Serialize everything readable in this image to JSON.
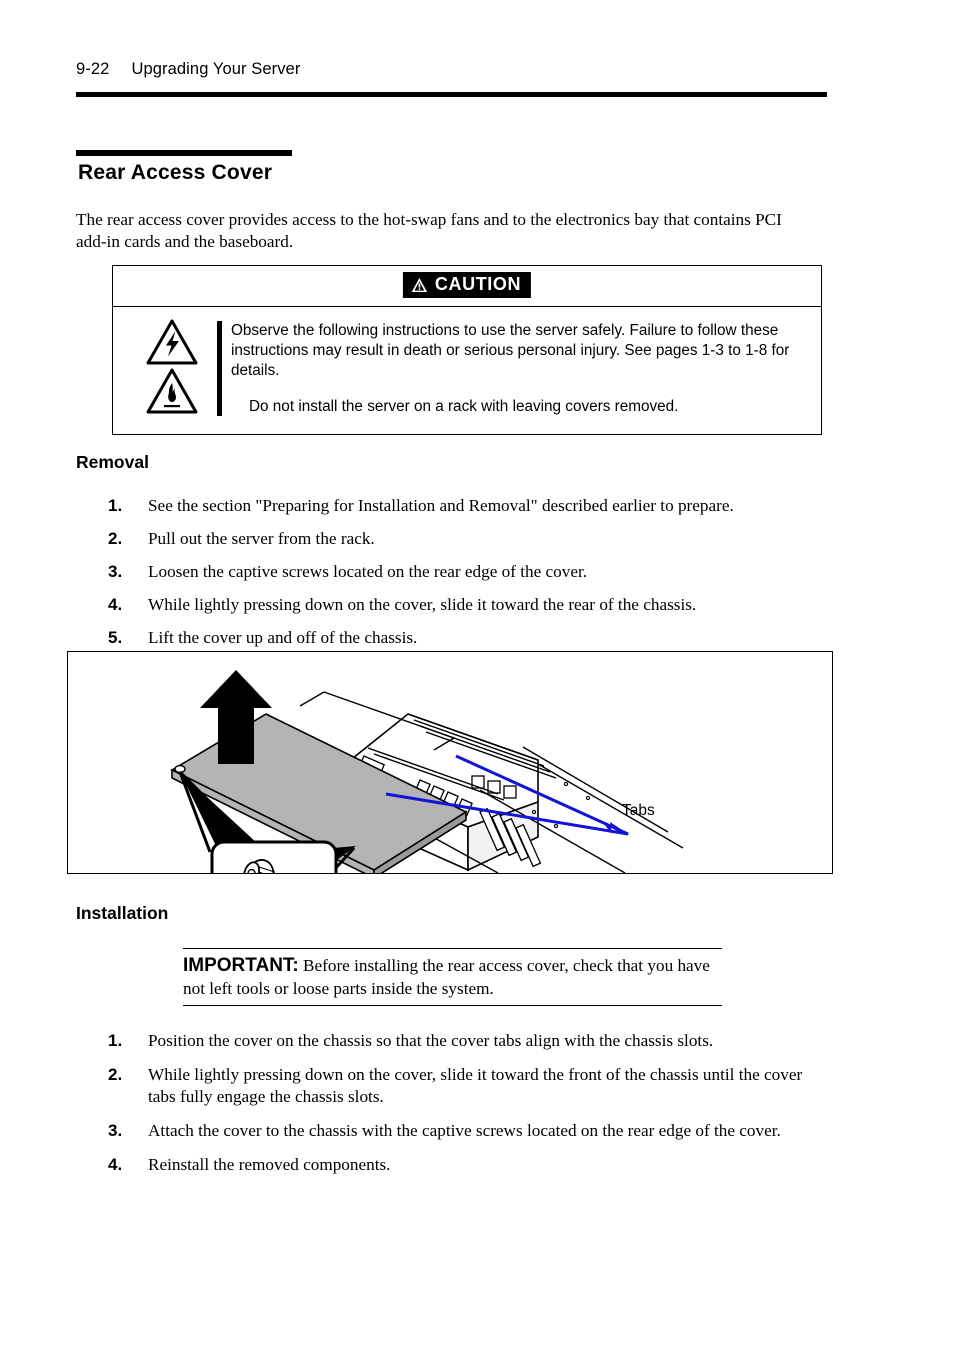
{
  "header": {
    "page_number": "9-22",
    "chapter_title": "Upgrading Your Server"
  },
  "section": {
    "title": "Rear Access Cover",
    "intro": "The rear access cover provides access to the hot-swap fans and to the electronics bay that contains PCI add-in cards and the baseboard."
  },
  "caution": {
    "label": "CAUTION",
    "warning_icon": "warning-triangle-icon",
    "hazard_icons": [
      "electric-shock-triangle-icon",
      "fire-hazard-triangle-icon"
    ],
    "body": "Observe the following instructions to use the server safely. Failure to follow these instructions may result in death or serious personal injury. See pages 1-3 to 1-8 for details.",
    "note": "Do not install the server on a rack with leaving covers removed."
  },
  "removal": {
    "heading": "Removal",
    "steps": [
      {
        "num": "1.",
        "text": "See the section \"Preparing for Installation and Removal\" described earlier to prepare."
      },
      {
        "num": "2.",
        "text": "Pull out the server from the rack."
      },
      {
        "num": "3.",
        "text": "Loosen the captive screws located on the rear edge of the cover."
      },
      {
        "num": "4.",
        "text": "While lightly pressing down on the cover, slide it toward the rear of the chassis."
      },
      {
        "num": "5.",
        "text": "Lift the cover up and off of the chassis."
      }
    ]
  },
  "figure": {
    "callout_label": "Tabs",
    "leader_color": "#1414d8",
    "cover_fill": "#b4b4b4",
    "arrow_fill": "#000000"
  },
  "installation": {
    "heading": "Installation",
    "important_keyword": "IMPORTANT:",
    "important_text": " Before installing the rear access cover, check that you have not left tools or loose parts inside the system.",
    "steps": [
      {
        "num": "1.",
        "text": "Position the cover on the chassis so that the cover tabs align with the chassis slots."
      },
      {
        "num": "2.",
        "text": "While lightly pressing down on the cover, slide it toward the front of the chassis until the cover tabs fully engage the chassis slots."
      },
      {
        "num": "3.",
        "text": "Attach the cover to the chassis with the captive screws located on the rear edge of the cover."
      },
      {
        "num": "4.",
        "text": "Reinstall the removed components."
      }
    ]
  }
}
